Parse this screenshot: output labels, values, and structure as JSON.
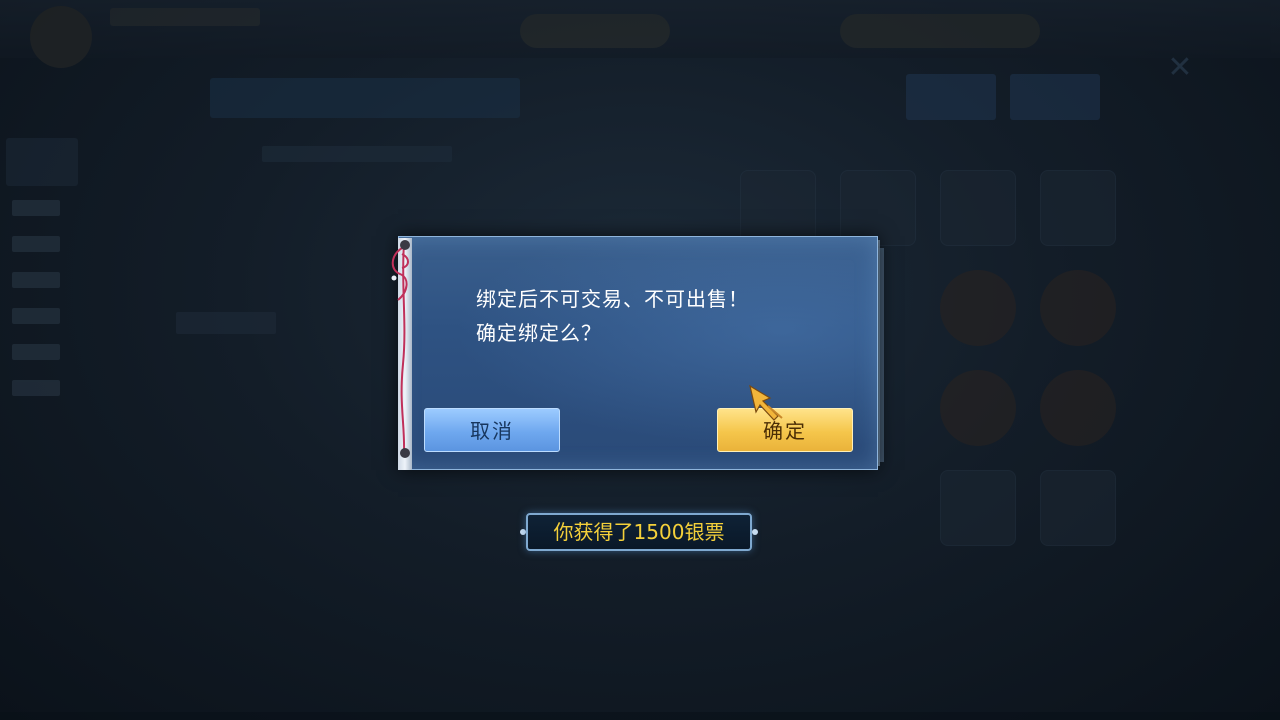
{
  "dialog": {
    "message_line1": "绑定后不可交易、不可出售！",
    "message_line2": "确定绑定么？",
    "cancel_label": "取消",
    "confirm_label": "确定"
  },
  "toast": {
    "text": "你获得了1500银票"
  },
  "colors": {
    "dialog_bg": "#2e5282",
    "cancel_button": "#6fa8ef",
    "confirm_button": "#f5c64b",
    "toast_text": "#f4d03a"
  },
  "icons": {
    "cursor": "arrow-cursor-icon",
    "close": "close-icon"
  }
}
